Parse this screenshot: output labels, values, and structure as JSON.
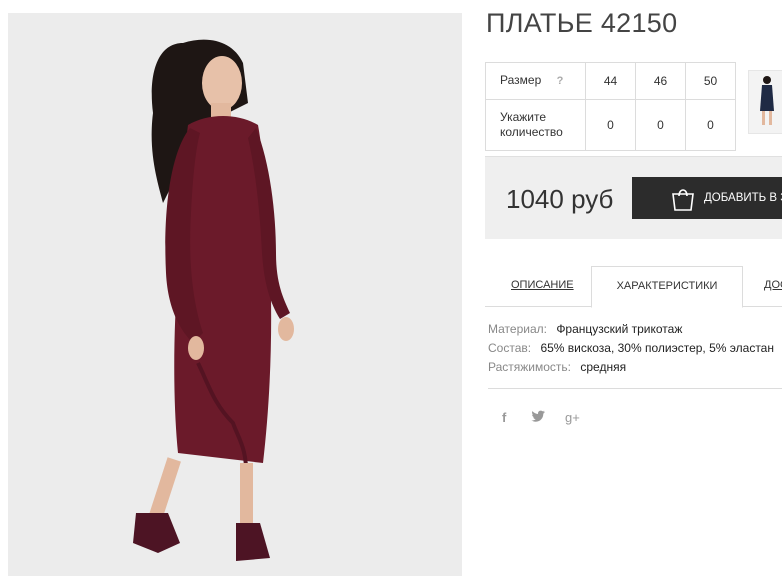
{
  "product": {
    "title": "ПЛАТЬЕ 42150"
  },
  "sizes": {
    "size_label": "Размер",
    "help_label": "?",
    "qty_label_line1": "Укажите",
    "qty_label_line2": "количество",
    "values": [
      "44",
      "46",
      "50"
    ],
    "quantities": [
      "0",
      "0",
      "0"
    ]
  },
  "purchase": {
    "price": "1040 руб",
    "add_label": "ДОБАВИТЬ В З"
  },
  "tabs": {
    "description": "ОПИСАНИЕ",
    "characteristics": "ХАРАКТЕРИСТИКИ",
    "extra": "ДОС"
  },
  "specs": [
    {
      "key": "Материал:",
      "value": "Французский трикотаж"
    },
    {
      "key": "Состав:",
      "value": "65% вискоза, 30% полиэстер, 5% эластан"
    },
    {
      "key": "Растяжимость:",
      "value": "средняя"
    }
  ],
  "social": {
    "facebook": "f",
    "twitter": "t",
    "googleplus": "g+"
  },
  "colors": {
    "dress": "#6b1a2a",
    "button": "#2c2c2c",
    "price_bg": "#efefef"
  }
}
